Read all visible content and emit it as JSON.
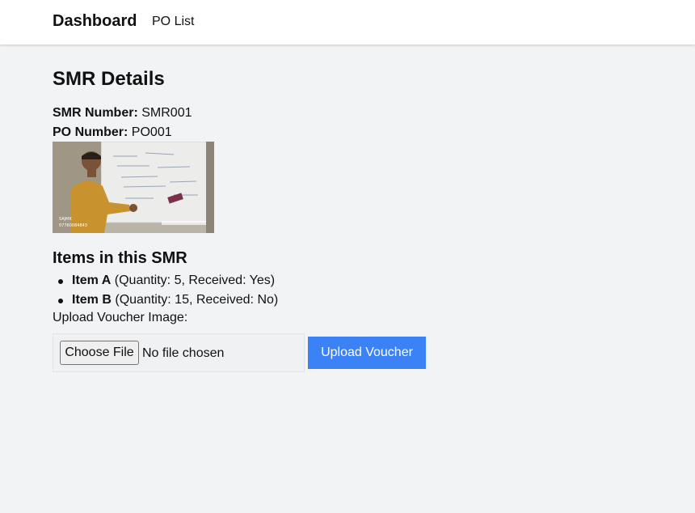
{
  "nav": {
    "brand": "Dashboard",
    "links": [
      {
        "label": "PO List"
      }
    ]
  },
  "main": {
    "title": "SMR Details",
    "smr_number_label": "SMR Number:",
    "smr_number_value": "SMR001",
    "po_number_label": "PO Number:",
    "po_number_value": "PO001",
    "items_heading": "Items in this SMR",
    "items": [
      {
        "name": "Item A",
        "details": "(Quantity: 5, Received: Yes)"
      },
      {
        "name": "Item B",
        "details": "(Quantity: 15, Received: No)"
      }
    ],
    "upload_label": "Upload Voucher Image:",
    "file_input": {
      "button_label": "Choose File",
      "status": "No file chosen"
    },
    "upload_button_label": "Upload Voucher"
  },
  "colors": {
    "page_background": "#f2f3f5",
    "navbar_background": "#ffffff",
    "accent_button": "#3b82f6"
  }
}
